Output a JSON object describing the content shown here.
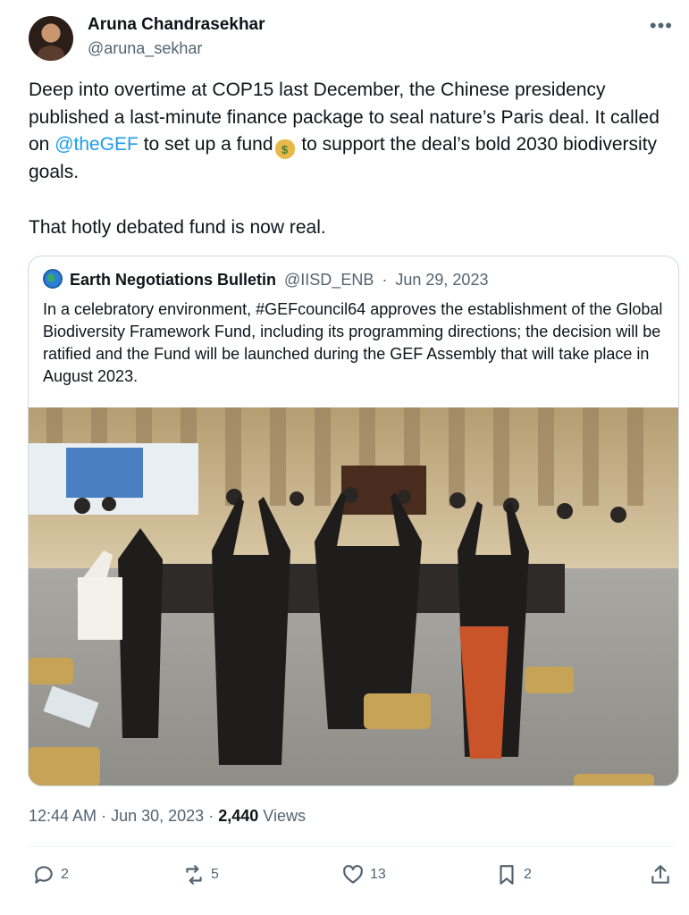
{
  "author": {
    "display_name": "Aruna Chandrasekhar",
    "handle": "@aruna_sekhar"
  },
  "menu_icon": "more-horizontal-icon",
  "tweet": {
    "text_part1": "Deep into overtime at COP15 last December, the Chinese presidency published a last-minute finance package to seal nature’s Paris deal. It called on ",
    "mention": "@theGEF",
    "text_part2": " to set up a fund",
    "emoji_icon": "money-bag-icon",
    "emoji_glyph": "$",
    "text_part3": " to support the deal’s bold 2030 biodiversity goals.",
    "paragraph2": "That hotly debated fund is now real."
  },
  "quoted": {
    "display_name": "Earth Negotiations Bulletin",
    "handle": "@IISD_ENB",
    "separator": "·",
    "date": "Jun 29, 2023",
    "text": "In a celebratory environment, #GEFcouncil64 approves the establishment of the Global Biodiversity Framework Fund, including its programming directions; the decision will be ratified and the Fund will be launched during the GEF Assembly that will take place in August 2023."
  },
  "meta": {
    "time": "12:44 AM",
    "separator": "·",
    "date": "Jun 30, 2023",
    "separator2": "·",
    "views_count": "2,440",
    "views_label": "Views"
  },
  "actions": {
    "replies": "2",
    "reposts": "5",
    "likes": "13",
    "bookmarks": "2"
  },
  "colors": {
    "link": "#1d9bf0",
    "secondary_text": "#536471",
    "primary_text": "#0f1419",
    "border": "#cfd9de"
  }
}
